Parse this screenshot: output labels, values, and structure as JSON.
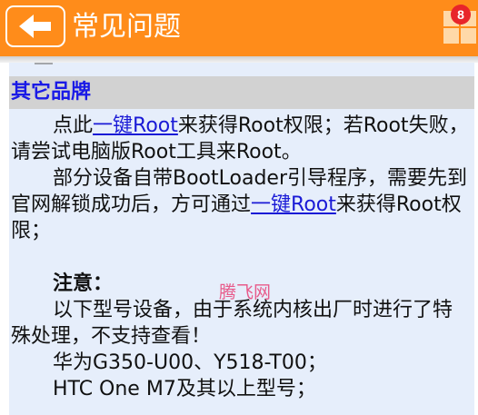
{
  "header": {
    "title": "常见问题",
    "badge_count": "8",
    "back_icon": "arrow-left-icon",
    "menu_icon": "grid-menu-icon",
    "bg_color": "#ff8c1a"
  },
  "section": {
    "title": "其它品牌",
    "title_color": "#1a1ae6",
    "header_bg": "#d2d2d2",
    "panel_bg": "#e6eefb"
  },
  "content": {
    "p1_before": "点此",
    "p1_link": "一键Root",
    "p1_after": "来获得Root权限；若Root失败，请尝试电脑版Root工具来Root。",
    "p2_before": "部分设备自带BootLoader引导程序，需要先到官网解锁成功后，方可通过",
    "p2_link": "一键Root",
    "p2_after": "来获得Root权限；",
    "note_label": "注意：",
    "note_text": "以下型号设备，由于系统内核出厂时进行了特殊处理，不支持查看！",
    "item_1": "华为G350-U00、Y518-T00；",
    "item_2": "HTC One M7及其以上型号；"
  },
  "watermark": "腾飞网"
}
